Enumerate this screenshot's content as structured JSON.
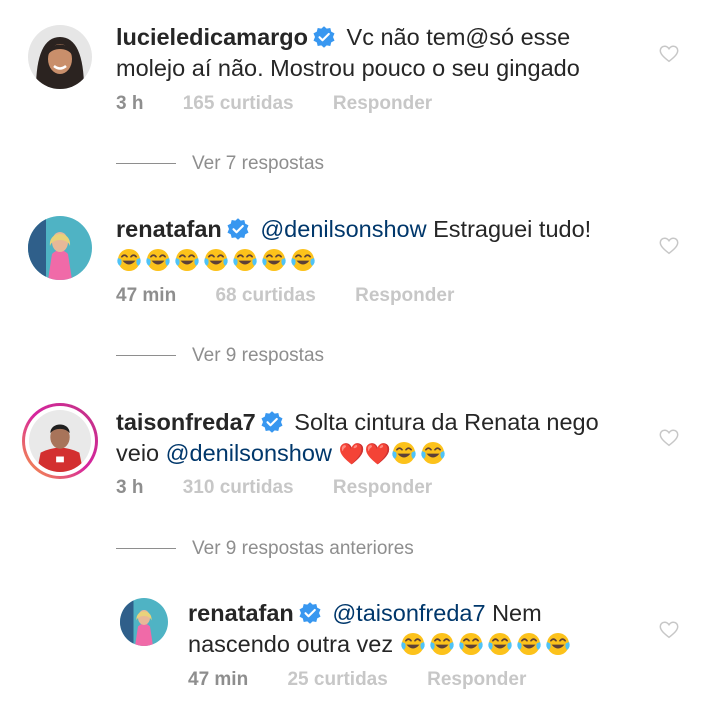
{
  "comments": [
    {
      "username": "lucieledicamargo",
      "body": "Vc não tem@só esse",
      "body2": "molejo aí não. Mostrou pouco o seu gingado",
      "time": "3 h",
      "likes": "165 curtidas",
      "reply": "Responder"
    },
    {
      "username": "renatafan",
      "mention": "@denilsonshow",
      "body": "Estraguei tudo!",
      "time": "47 min",
      "likes": "68 curtidas",
      "reply": "Responder"
    },
    {
      "username": "taisonfreda7",
      "body": "Solta cintura da Renata nego",
      "body2_prefix": "veio",
      "mention": "@denilsonshow",
      "time": "3 h",
      "likes": "310 curtidas",
      "reply": "Responder"
    },
    {
      "username": "renatafan",
      "mention": "@taisonfreda7",
      "body": "Nem",
      "body2": "nascendo outra vez",
      "time": "47 min",
      "likes": "25 curtidas",
      "reply": "Responder"
    }
  ],
  "view_replies": [
    "Ver 7 respostas",
    "Ver 9 respostas",
    "Ver 9 respostas anteriores"
  ],
  "icons": {
    "verified": "verified-badge-icon",
    "like": "heart-outline-icon",
    "laugh": "face-with-tears-of-joy-emoji",
    "heart": "red-heart-emoji"
  },
  "colors": {
    "verified_blue": "#3897f0",
    "mention": "#00376b",
    "meta_gray": "#8e8e8e",
    "meta_light": "#c7c7c7"
  }
}
